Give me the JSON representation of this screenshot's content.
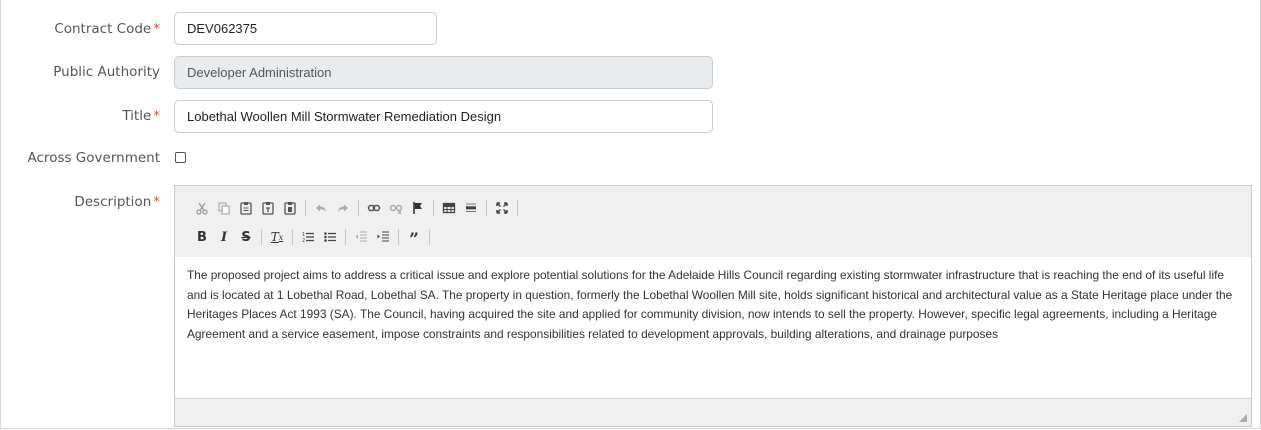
{
  "form": {
    "contract_code": {
      "label": "Contract Code",
      "required_mark": "*",
      "value": "DEV062375"
    },
    "public_authority": {
      "label": "Public Authority",
      "value": "Developer Administration"
    },
    "title": {
      "label": "Title",
      "required_mark": "*",
      "value": "Lobethal Woollen Mill Stormwater Remediation Design"
    },
    "across_government": {
      "label": "Across Government",
      "checked": false
    },
    "description": {
      "label": "Description",
      "required_mark": "*",
      "text": "The proposed project aims to address a critical issue and explore potential solutions for the Adelaide Hills Council regarding existing stormwater infrastructure that is reaching the end of its useful life and is located at 1 Lobethal Road, Lobethal SA. The property in question, formerly the Lobethal Woollen Mill site, holds significant historical and architectural value as a State Heritage place under the Heritages Places Act 1993 (SA). The Council, having acquired the site and applied for community division, now intends to sell the property. However, specific legal agreements, including a Heritage Agreement and a service easement, impose constraints and responsibilities related to development approvals, building alterations, and drainage purposes"
    }
  },
  "toolbar": {
    "row1": [
      "cut-icon",
      "copy-icon",
      "paste-icon",
      "paste-text-icon",
      "paste-word-icon",
      "undo-icon",
      "redo-icon",
      "link-icon",
      "unlink-icon",
      "anchor-icon",
      "table-icon",
      "horizontal-rule-icon",
      "maximize-icon"
    ],
    "row2": [
      "bold-icon",
      "italic-icon",
      "strikethrough-icon",
      "remove-format-icon",
      "numbered-list-icon",
      "bulleted-list-icon",
      "outdent-icon",
      "indent-icon",
      "blockquote-icon"
    ]
  },
  "colors": {
    "required": "#d9534f",
    "disabled_bg": "#e9ecef",
    "toolbar_bg": "#f0f0f0"
  }
}
